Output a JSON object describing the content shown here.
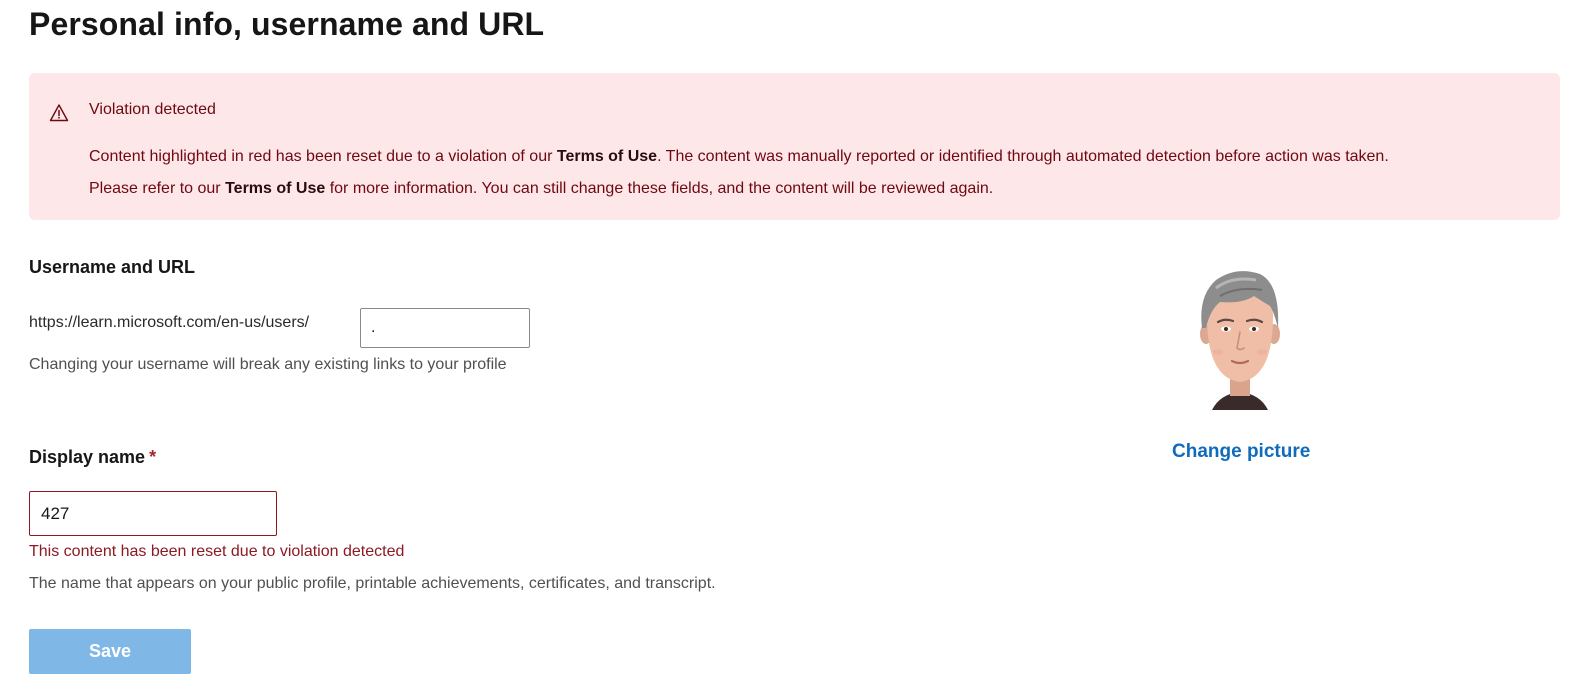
{
  "page": {
    "title": "Personal info, username and URL"
  },
  "alert": {
    "icon": "warning-triangle-icon",
    "title": "Violation detected",
    "line1_before": "Content highlighted in red has been reset due to a violation of our ",
    "terms_link_1": "Terms of Use",
    "line1_after": ". The content was manually reported or identified through automated detection before action was taken.",
    "line2_before": "Please refer to our ",
    "terms_link_2": "Terms of Use",
    "line2_after": " for more information. You can still change these fields, and the content will be reviewed again.",
    "background_color": "#fde7e9",
    "text_color": "#6e0811"
  },
  "username_section": {
    "heading": "Username and URL",
    "url_prefix": "https://learn.microsoft.com/en-us/users/",
    "username_value": ".",
    "hint": "Changing your username will break any existing links to your profile"
  },
  "display_name": {
    "label": "Display name",
    "required_marker": "*",
    "value": "427",
    "error": "This content has been reset due to violation detected",
    "hint": "The name that appears on your public profile, printable achievements, certificates, and transcript."
  },
  "profile_picture": {
    "avatar_icon": "avatar-cartoon-icon",
    "change_label": "Change picture",
    "link_color": "#0f6cbd"
  },
  "actions": {
    "save_label": "Save",
    "save_color": "#7fb8e6"
  }
}
